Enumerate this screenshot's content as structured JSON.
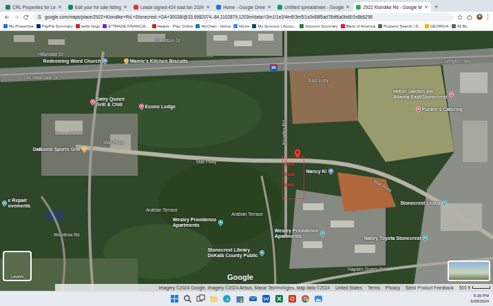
{
  "tabs": [
    {
      "label": "CRL Properties for Le",
      "selected": false
    },
    {
      "label": "Edit your for sale listing",
      "selected": false
    },
    {
      "label": "Lease signed 424 east lan 2024",
      "selected": false
    },
    {
      "label": "Home - Google Drive",
      "selected": false
    },
    {
      "label": "Untitled spreadsheet - Google",
      "selected": false
    },
    {
      "label": "2922 Klondike Rd - Google M",
      "selected": true
    }
  ],
  "new_tab": "+",
  "address_bar": {
    "url": "google.com/maps/place/2922+Klondike+Rd,+Stonecrest,+GA+30038/@33.6982074,-84.1102879,1203m/data=!3m1!1e3!4m6!3m5!1s0x88f5ad78df6a0bd8:0x8b6298"
  },
  "bookmarks": [
    "My Properties",
    "PayPal Summary",
    "wells fargo",
    "E*TRADE FINANCIA...",
    "Hearts - Play Online",
    "MyChart - Home",
    "Home",
    "My Synovus | Accou...",
    "Account Summary",
    "Bank of America",
    "Property Search | D...",
    "GEORGIA",
    "All Bo"
  ],
  "map": {
    "labels": [
      {
        "text": "Davidson Dr",
        "kind": "road"
      },
      {
        "text": "Redeeming Word Church",
        "kind": "poi",
        "color": "#4a7fd9"
      },
      {
        "text": "Mamie's Kitchen Biscuits",
        "kind": "poi",
        "color": "#f29900"
      },
      {
        "text": "Hillandale Dr",
        "kind": "road"
      },
      {
        "text": "Old Hillandale Dr",
        "kind": "road"
      },
      {
        "text": "20",
        "kind": "shield"
      },
      {
        "text": "East Expy",
        "kind": "road"
      },
      {
        "text": "Covington Hwy",
        "kind": "road"
      },
      {
        "text": "Hilton Garden Inn\nAtlanta East/Stonecrest",
        "kind": "poi",
        "color": "#e8457a"
      },
      {
        "text": "Punkin's Catering",
        "kind": "poi",
        "color": "#e8457a"
      },
      {
        "text": "Dairy Queen\nGrill & Chill",
        "kind": "poi",
        "color": "#e8457a"
      },
      {
        "text": "Econo Lodge",
        "kind": "poi",
        "color": "#e8457a"
      },
      {
        "text": "Evans Mill Rd",
        "kind": "road"
      },
      {
        "text": "DaBomb Sports Grill",
        "kind": "poi",
        "color": "#f29900"
      },
      {
        "text": "Mall Pkwy",
        "kind": "road"
      },
      {
        "text": "Mall Pkwy",
        "kind": "road"
      },
      {
        "text": "Klondike Rd",
        "kind": "road"
      },
      {
        "text": "Nancy Ki",
        "kind": "poi",
        "color": "#4a7fd9"
      },
      {
        "text": "Mall Pkwy",
        "kind": "road"
      },
      {
        "text": "Stonecrest Lexus",
        "kind": "poi",
        "color": "#129eaf"
      },
      {
        "text": "Arabian Terrace",
        "kind": "road"
      },
      {
        "text": "Arabian Terrace",
        "kind": "road"
      },
      {
        "text": "Wesley Providence\nApartments",
        "kind": "poi",
        "color": "#129eaf"
      },
      {
        "text": "Wesley Providence\nApartments",
        "kind": "poi",
        "color": "#129eaf"
      },
      {
        "text": "Stonecrest Library\nDeKalb County Public",
        "kind": "poi",
        "color": "#129eaf"
      },
      {
        "text": "Nalley Toyota Stonecrest",
        "kind": "poi",
        "color": "#129eaf"
      },
      {
        "text": "Hayden Quarry Rd",
        "kind": "road"
      },
      {
        "text": "Woodrow Rd",
        "kind": "road"
      },
      {
        "text": "e Repair\novements",
        "kind": "poi",
        "color": "#129eaf"
      }
    ],
    "parcel_labels": [
      "2922",
      "2932",
      "2942"
    ],
    "layers": "Layers",
    "logo": "Google",
    "footer": {
      "attribution": "Imagery ©2024 Google, Imagery ©2024 Airbus, Maxar Technologies, Map data ©2024",
      "links": [
        "United States",
        "Terms",
        "Privacy",
        "Send Product Feedback"
      ],
      "scale": "500 ft"
    }
  },
  "taskbar": {
    "time": "5:36 PM",
    "date": "5/28/2024"
  }
}
